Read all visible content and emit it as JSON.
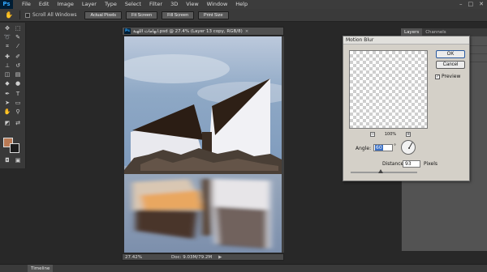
{
  "app": {
    "logo": "Ps"
  },
  "menu": {
    "items": [
      "File",
      "Edit",
      "Image",
      "Layer",
      "Type",
      "Select",
      "Filter",
      "3D",
      "View",
      "Window",
      "Help"
    ]
  },
  "window_controls": {
    "minimize": "–",
    "restore": "□",
    "close": "✕"
  },
  "options_bar": {
    "scroll_all_label": "Scroll All Windows",
    "buttons": [
      "Actual Pixels",
      "Fit Screen",
      "Fill Screen",
      "Print Size"
    ]
  },
  "document": {
    "title": "ابهامات اللهبة.psd @ 27.4% (Layer 13 copy, RGB/8)",
    "close": "×",
    "status_zoom": "27.42%",
    "status_info": "Doc: 9.03M/79.2M",
    "status_arrow": "▶"
  },
  "panels": {
    "tabs": [
      "Layers",
      "Channels"
    ]
  },
  "dialog": {
    "title": "Motion Blur",
    "ok_label": "OK",
    "cancel_label": "Cancel",
    "preview_label": "Preview",
    "preview_checked": "✓",
    "zoom_minus": "−",
    "zoom_plus": "+",
    "zoom_value": "100%",
    "angle_label": "Angle:",
    "angle_value": "60",
    "degree": "°",
    "distance_label": "Distance:",
    "distance_value": "93",
    "distance_unit": "Pixels"
  },
  "bottom": {
    "timeline_label": "Timeline"
  },
  "colors": {
    "foreground": "#b87954",
    "background": "#1b1b1b",
    "ok_border": "#2a5aa0",
    "selection": "#3a6fc4"
  },
  "icons": [
    "move-icon",
    "marquee-icon",
    "lasso-icon",
    "quick-select-icon",
    "crop-icon",
    "eyedropper-icon",
    "healing-icon",
    "brush-icon",
    "stamp-icon",
    "history-brush-icon",
    "eraser-icon",
    "gradient-icon",
    "blur-icon",
    "dodge-icon",
    "pen-icon",
    "type-icon",
    "path-select-icon",
    "shape-icon",
    "hand-icon",
    "zoom-icon"
  ]
}
